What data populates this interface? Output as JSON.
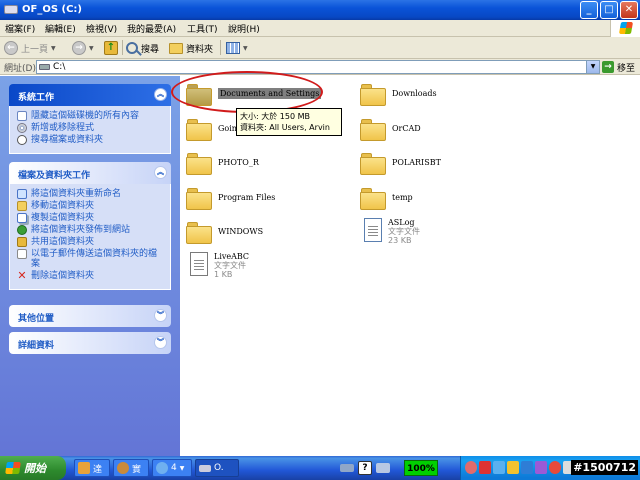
{
  "window": {
    "title": "OF_OS (C:)"
  },
  "menu": [
    "檔案(F)",
    "編輯(E)",
    "檢視(V)",
    "我的最愛(A)",
    "工具(T)",
    "說明(H)"
  ],
  "toolbar": {
    "back": "上一頁",
    "search": "搜尋",
    "folders": "資料夾"
  },
  "address": {
    "label": "網址(D)",
    "value": "C:\\",
    "go": "移至"
  },
  "sidebar": {
    "system": {
      "title": "系統工作",
      "items": [
        "隱藏這個磁碟機的所有內容",
        "新增或移除程式",
        "搜尋檔案或資料夾"
      ]
    },
    "files": {
      "title": "檔案及資料夾工作",
      "items": [
        "將這個資料夾重新命名",
        "移動這個資料夾",
        "複製這個資料夾",
        "將這個資料夾發佈到網站",
        "共用這個資料夾",
        "以電子郵件傳送這個資料夾的檔案",
        "刪除這個資料夾"
      ]
    },
    "other": {
      "title": "其他位置"
    },
    "details": {
      "title": "詳細資料"
    }
  },
  "files": [
    {
      "name": "Documents and Settings",
      "type": "folder",
      "selected": true
    },
    {
      "name": "Downloads",
      "type": "folder"
    },
    {
      "name": "Going",
      "type": "folder"
    },
    {
      "name": "OrCAD",
      "type": "folder"
    },
    {
      "name": "PHOTO_R",
      "type": "folder"
    },
    {
      "name": "POLARISBT",
      "type": "folder"
    },
    {
      "name": "Program Files",
      "type": "folder"
    },
    {
      "name": "temp",
      "type": "folder"
    },
    {
      "name": "WINDOWS",
      "type": "folder"
    },
    {
      "name": "ASLog",
      "type": "text",
      "kind": "文字文件",
      "size": "23 KB"
    },
    {
      "name": "LiveABC",
      "type": "text",
      "kind": "文字文件",
      "size": "1 KB"
    }
  ],
  "tooltip": {
    "line1": "大小: 大於 150 MB",
    "line2": "資料夾: All Users, Arvin"
  },
  "taskbar": {
    "start": "開始",
    "buttons": [
      "達",
      "實",
      "4",
      "O."
    ],
    "zoom": "100%",
    "clock": "#1500712"
  },
  "colors": {
    "annotation": "#d11b1b",
    "titlebar": "#0a53d8",
    "start": "#2d8a2d"
  }
}
